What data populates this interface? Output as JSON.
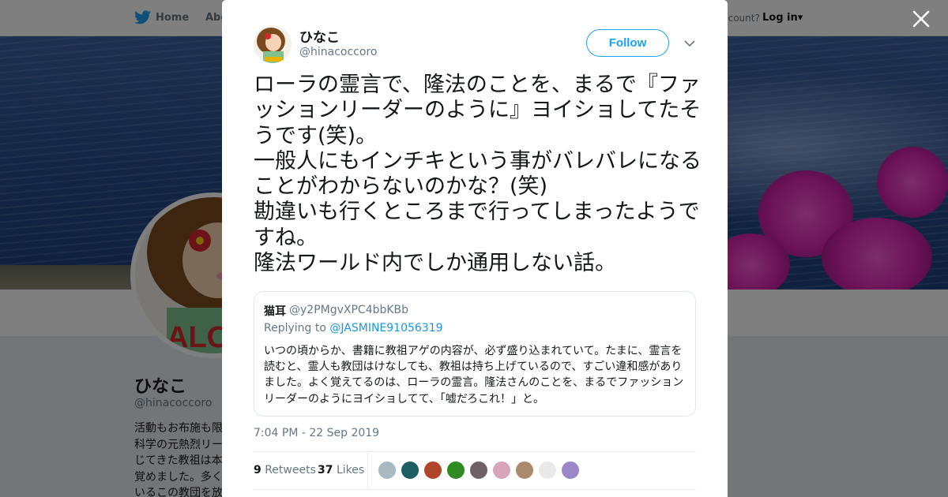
{
  "nav": {
    "home_label": "Home",
    "about_label": "Abo",
    "account_prompt": "ccount?",
    "login_label": "Log in"
  },
  "profile": {
    "name": "ひなこ",
    "handle": "@hinacoccoro",
    "bio_lines": [
      "活動もお布施も限",
      "科学の元熱烈リー",
      "じてきた教祖は本",
      "覚めました。多く",
      "いるこの教団を放"
    ]
  },
  "tweet": {
    "author_name": "ひなこ",
    "author_handle": "@hinacoccoro",
    "follow_label": "Follow",
    "text": "ローラの霊言で、隆法のことを、まるで『ファッションリーダーのように』ヨイショしてたそうです(笑)。\n一般人にもインチキという事がバレバレになることがわからないのかな？(笑)\n勘違いも行くところまで行ってしまったようですね。\n隆法ワールド内でしか通用しない話。",
    "timestamp": "7:04 PM - 22 Sep 2019",
    "retweets_count": "9",
    "retweets_label": "Retweets",
    "likes_count": "37",
    "likes_label": "Likes"
  },
  "quoted": {
    "name": "猫耳",
    "handle": "@y2PMgvXPC4bbKBb",
    "replying_prefix": "Replying to ",
    "replying_to": "@JASMINE91056319",
    "text": "いつの頃からか、書籍に教祖アゲの内容が、必ず盛り込まれていて。たまに、霊言を読むと、霊人も教団はけなしても、教祖は持ち上げているので、すごい違和感がありました。よく覚えてるのは、ローラの霊言。隆法さんのことを、まるでファッションリーダーのようにヨイショしてて、「嘘だろこれ！」と。"
  },
  "likers": [
    {
      "name": "liker-1-avatar",
      "color": "#aab8c2"
    },
    {
      "name": "liker-2-avatar",
      "color": "#1c5e63"
    },
    {
      "name": "liker-3-avatar",
      "color": "#b0452a"
    },
    {
      "name": "liker-4-avatar",
      "color": "#2e8a21"
    },
    {
      "name": "liker-5-avatar",
      "color": "#6e6166"
    },
    {
      "name": "liker-6-avatar",
      "color": "#d8a4b8"
    },
    {
      "name": "liker-7-avatar",
      "color": "#a98a6d"
    },
    {
      "name": "liker-8-avatar",
      "color": "#e9e9e9"
    },
    {
      "name": "liker-9-avatar",
      "color": "#9b86c9"
    }
  ],
  "colors": {
    "brand_blue": "#1da1f2",
    "link_blue": "#1b95e0",
    "text_primary": "#14171a",
    "text_secondary": "#657786"
  },
  "icons": {
    "logo": "twitter-bird-icon",
    "close": "close-icon",
    "menu": "chevron-down-icon"
  }
}
